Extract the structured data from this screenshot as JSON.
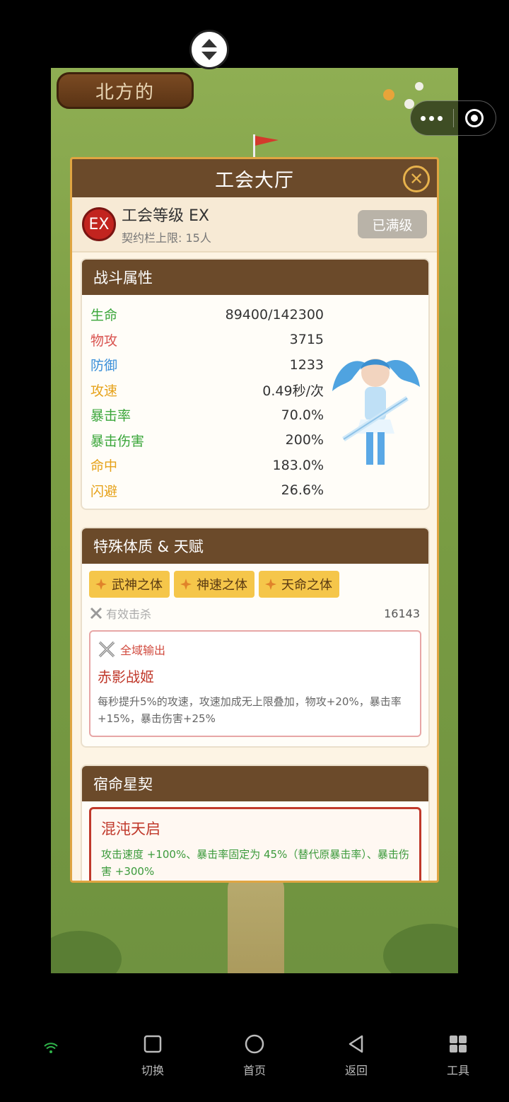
{
  "game": {
    "player_name": "北方的"
  },
  "modal": {
    "title": "工会大厅",
    "guild": {
      "badge": "EX",
      "level_label": "工会等级 EX",
      "contract_limit": "契约栏上限: 15人",
      "max_button": "已满级"
    },
    "combat": {
      "title": "战斗属性",
      "stats": [
        {
          "name": "生命",
          "value": "89400/142300",
          "color": "#3aa63a"
        },
        {
          "name": "物攻",
          "value": "3715",
          "color": "#d9534f"
        },
        {
          "name": "防御",
          "value": "1233",
          "color": "#3a8fd9"
        },
        {
          "name": "攻速",
          "value": "0.49秒/次",
          "color": "#e6a21a"
        },
        {
          "name": "暴击率",
          "value": "70.0%",
          "color": "#3aa63a"
        },
        {
          "name": "暴击伤害",
          "value": "200%",
          "color": "#3aa63a"
        },
        {
          "name": "命中",
          "value": "183.0%",
          "color": "#e6a21a"
        },
        {
          "name": "闪避",
          "value": "26.6%",
          "color": "#e6a21a"
        }
      ]
    },
    "talents": {
      "title": "特殊体质 & 天赋",
      "items": [
        "武神之体",
        "神速之体",
        "天命之体"
      ],
      "kills_label": "有效击杀",
      "kills_value": "16143",
      "skill": {
        "tag": "全域输出",
        "name": "赤影战姬",
        "desc": "每秒提升5%的攻速，攻速加成无上限叠加，物攻+20%，暴击率+15%，暴击伤害+25%"
      }
    },
    "fate": {
      "title": "宿命星契",
      "name": "混沌天启",
      "desc": "攻击速度 +100%、暴击率固定为 45%（替代原暴击率）、暴击伤害 +300%"
    }
  },
  "navbar": {
    "items": [
      {
        "label": "切换",
        "icon": "square-icon"
      },
      {
        "label": "首页",
        "icon": "circle-icon"
      },
      {
        "label": "返回",
        "icon": "back-triangle-icon"
      },
      {
        "label": "工具",
        "icon": "grid-icon"
      }
    ]
  },
  "colors": {
    "header_brown": "#6b4a2a",
    "accent_gold": "#e0a542",
    "talent_yellow": "#f5c64a",
    "danger_red": "#c0392b"
  }
}
